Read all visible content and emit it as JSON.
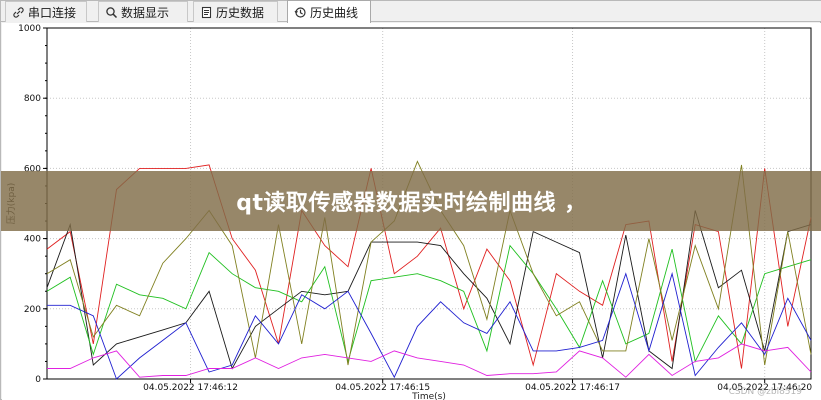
{
  "tabs": [
    {
      "label": "串口连接",
      "icon": "link-icon",
      "active": false
    },
    {
      "label": "数据显示",
      "icon": "search-icon",
      "active": false
    },
    {
      "label": "历史数据",
      "icon": "document-icon",
      "active": false
    },
    {
      "label": "历史曲线",
      "icon": "history-icon",
      "active": true
    }
  ],
  "banner": {
    "text": "qt读取传感器数据实时绘制曲线 ，"
  },
  "watermark": {
    "text": "CSDN @zbl8519"
  },
  "chart_data": {
    "type": "line",
    "xlabel": "Time(s)",
    "ylabel": "压力(kpa)",
    "ylim": [
      0,
      1000
    ],
    "yticks": [
      0,
      200,
      400,
      600,
      800,
      1000
    ],
    "xtick_labels": [
      "04.05.2022 17:46:12",
      "04.05.2022 17:46:15",
      "04.05.2022 17:46:17",
      "04.05.2022 17:46:20"
    ],
    "xtick_positions": [
      6.2,
      14.5,
      22.7,
      31.0
    ],
    "xlim": [
      0,
      33
    ],
    "grid": true,
    "series": [
      {
        "color": "#e02020",
        "x": [
          0,
          1,
          2,
          3,
          4,
          5,
          6,
          7,
          8,
          9,
          10,
          11,
          12,
          13,
          14,
          15,
          16,
          17,
          18,
          19,
          20,
          21,
          22,
          23,
          24,
          25,
          26,
          27,
          28,
          29,
          30,
          31,
          32,
          33
        ],
        "y": [
          370,
          420,
          100,
          540,
          600,
          600,
          600,
          610,
          400,
          310,
          100,
          480,
          380,
          320,
          600,
          300,
          350,
          430,
          200,
          370,
          280,
          40,
          300,
          250,
          210,
          440,
          450,
          50,
          440,
          420,
          30,
          600,
          150,
          460
        ]
      },
      {
        "color": "#1a1a1a",
        "x": [
          0,
          1,
          2,
          3,
          4,
          5,
          6,
          7,
          8,
          9,
          10,
          11,
          12,
          13,
          14,
          15,
          16,
          17,
          18,
          19,
          20,
          21,
          22,
          23,
          24,
          25,
          26,
          27,
          28,
          29,
          30,
          31,
          32,
          33
        ],
        "y": [
          260,
          440,
          40,
          100,
          120,
          140,
          160,
          250,
          30,
          150,
          200,
          250,
          240,
          250,
          390,
          390,
          390,
          380,
          300,
          230,
          100,
          420,
          390,
          360,
          60,
          410,
          80,
          30,
          480,
          260,
          310,
          80,
          420,
          440
        ]
      },
      {
        "color": "#20c020",
        "x": [
          0,
          1,
          2,
          3,
          4,
          5,
          6,
          7,
          8,
          9,
          10,
          11,
          12,
          13,
          14,
          15,
          16,
          17,
          18,
          19,
          20,
          21,
          22,
          23,
          24,
          25,
          26,
          27,
          28,
          29,
          30,
          31,
          32,
          33
        ],
        "y": [
          250,
          290,
          70,
          270,
          240,
          230,
          200,
          360,
          300,
          260,
          250,
          220,
          320,
          50,
          280,
          290,
          300,
          280,
          250,
          80,
          380,
          300,
          200,
          90,
          280,
          100,
          130,
          370,
          50,
          180,
          100,
          300,
          320,
          340
        ]
      },
      {
        "color": "#808020",
        "x": [
          0,
          1,
          2,
          3,
          4,
          5,
          6,
          7,
          8,
          9,
          10,
          11,
          12,
          13,
          14,
          15,
          16,
          17,
          18,
          19,
          20,
          21,
          22,
          23,
          24,
          25,
          26,
          27,
          28,
          29,
          30,
          31,
          32,
          33
        ],
        "y": [
          300,
          340,
          120,
          210,
          180,
          330,
          400,
          480,
          380,
          60,
          440,
          100,
          460,
          40,
          390,
          450,
          620,
          480,
          380,
          170,
          480,
          300,
          180,
          220,
          80,
          80,
          400,
          110,
          380,
          200,
          610,
          40,
          420,
          70
        ]
      },
      {
        "color": "#2020d0",
        "x": [
          0,
          1,
          2,
          3,
          4,
          5,
          6,
          7,
          8,
          9,
          10,
          11,
          12,
          13,
          14,
          15,
          16,
          17,
          18,
          19,
          20,
          21,
          22,
          23,
          24,
          25,
          26,
          27,
          28,
          29,
          30,
          31,
          32,
          33
        ],
        "y": [
          210,
          210,
          180,
          0,
          60,
          110,
          160,
          20,
          40,
          180,
          100,
          240,
          200,
          250,
          130,
          5,
          150,
          220,
          160,
          130,
          220,
          80,
          80,
          90,
          110,
          300,
          80,
          300,
          10,
          90,
          160,
          70,
          230,
          110
        ]
      },
      {
        "color": "#e020e0",
        "x": [
          0,
          1,
          2,
          3,
          4,
          5,
          6,
          7,
          8,
          9,
          10,
          11,
          12,
          13,
          14,
          15,
          16,
          17,
          18,
          19,
          20,
          21,
          22,
          23,
          24,
          25,
          26,
          27,
          28,
          29,
          30,
          31,
          32,
          33
        ],
        "y": [
          30,
          30,
          60,
          80,
          5,
          10,
          10,
          30,
          30,
          60,
          30,
          60,
          70,
          60,
          50,
          80,
          60,
          50,
          40,
          10,
          15,
          15,
          20,
          80,
          60,
          5,
          70,
          10,
          50,
          60,
          100,
          80,
          90,
          20
        ]
      }
    ]
  }
}
